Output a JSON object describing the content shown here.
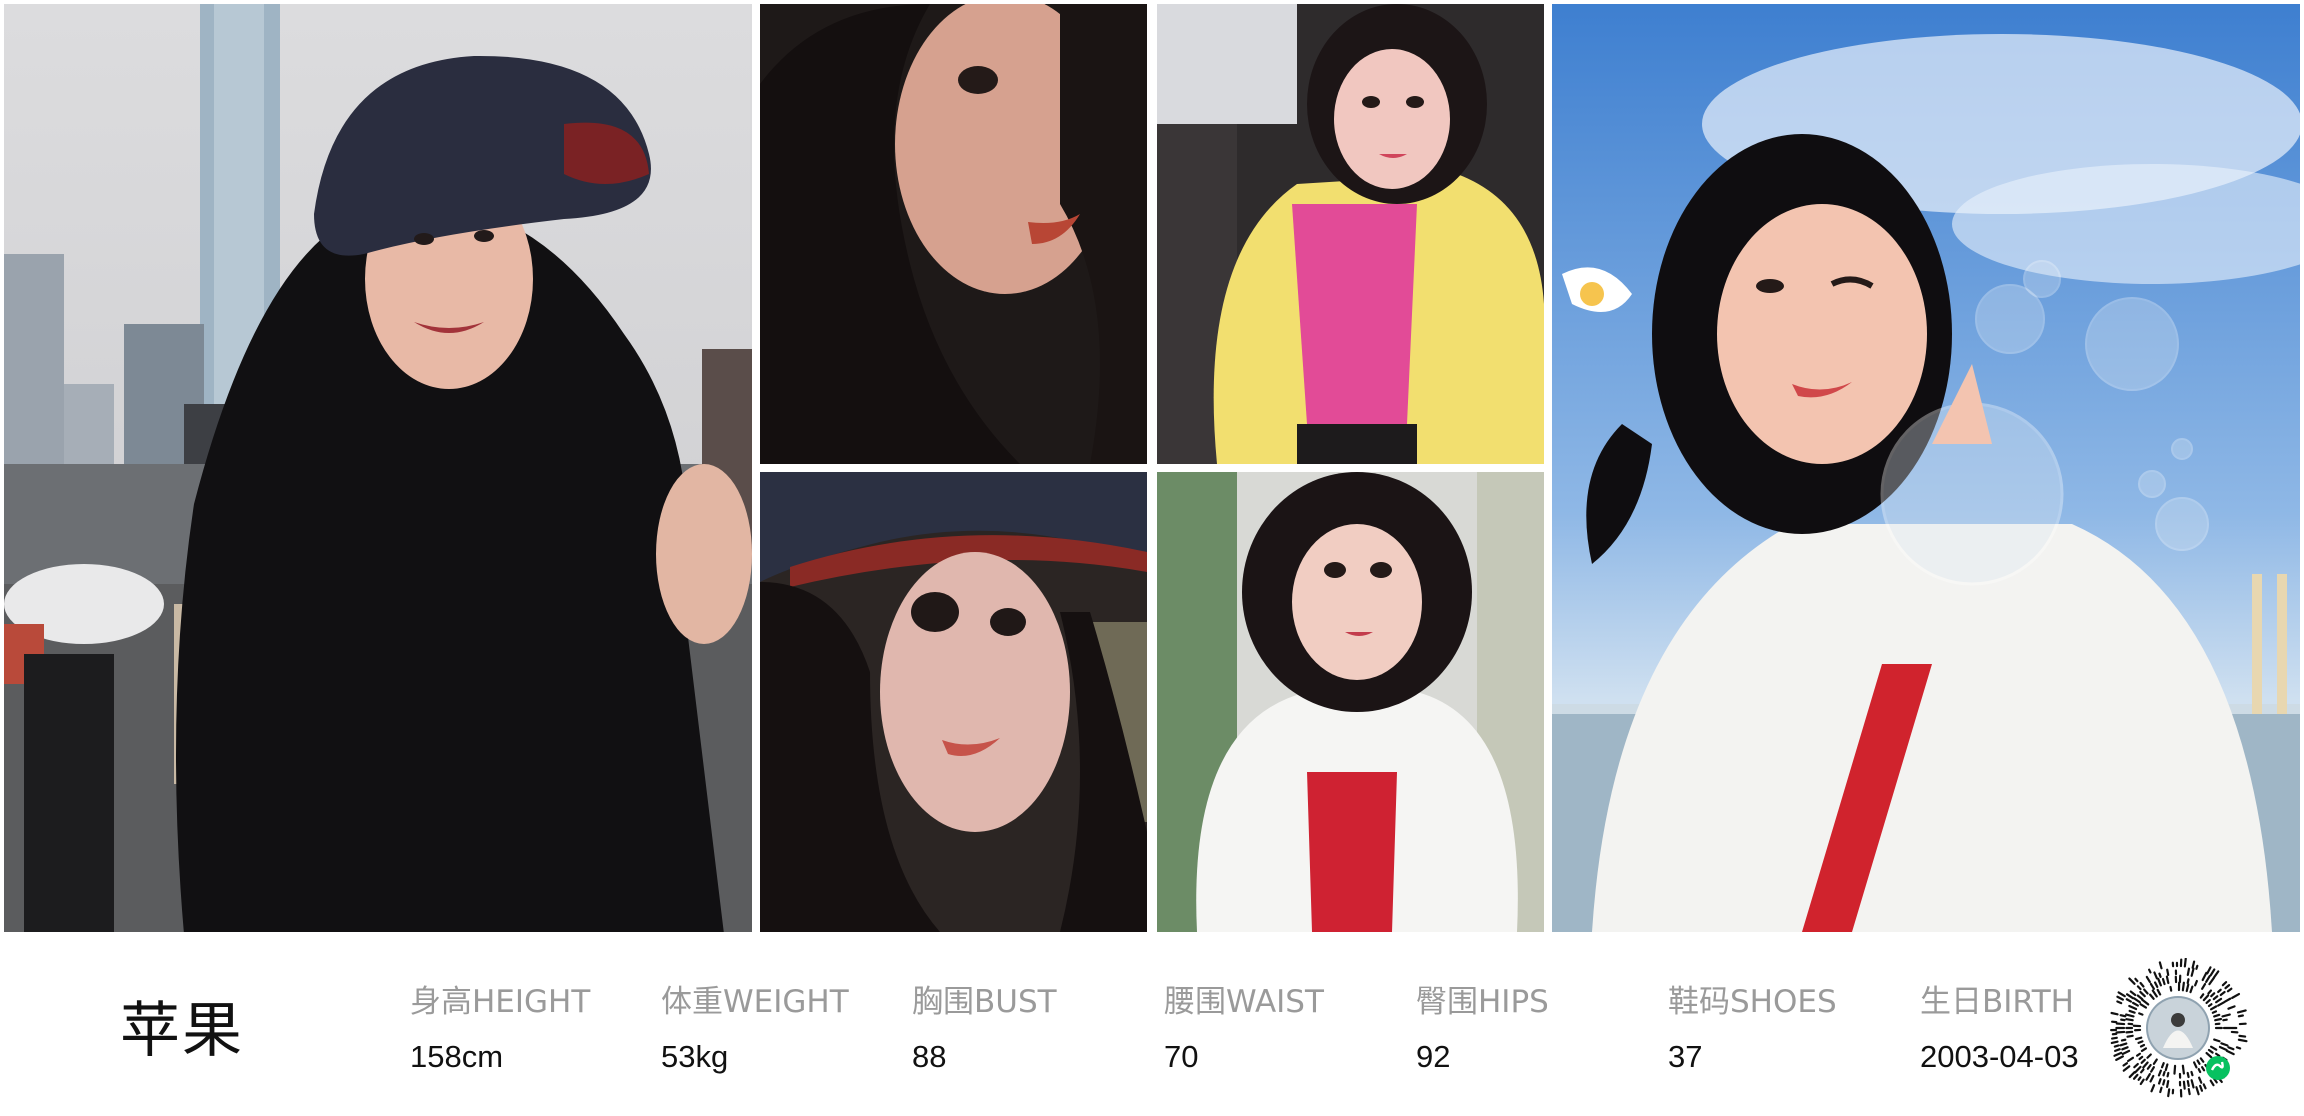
{
  "profile": {
    "name": "苹果",
    "stats": [
      {
        "label": "身高HEIGHT",
        "value": "158cm"
      },
      {
        "label": "体重WEIGHT",
        "value": "53kg"
      },
      {
        "label": "胸围BUST",
        "value": "88"
      },
      {
        "label": "腰围WAIST",
        "value": "70"
      },
      {
        "label": "臀围HIPS",
        "value": "92"
      },
      {
        "label": "鞋码SHOES",
        "value": "37"
      },
      {
        "label": "生日BIRTH",
        "value": "2003-04-03"
      }
    ]
  },
  "colors": {
    "background": "#ffffff",
    "label": "#9a9a9a",
    "value": "#111111",
    "badge": "#07c160"
  },
  "photos": [
    {
      "name": "street-portrait-photo"
    },
    {
      "name": "closeup-selfie-photo"
    },
    {
      "name": "car-selfie-photo"
    },
    {
      "name": "hat-closeup-photo"
    },
    {
      "name": "white-shirt-selfie-photo"
    },
    {
      "name": "seaside-bubbles-photo"
    }
  ],
  "qr": {
    "icon": "mini-program-code-icon",
    "badge_icon": "mini-program-badge-icon"
  }
}
